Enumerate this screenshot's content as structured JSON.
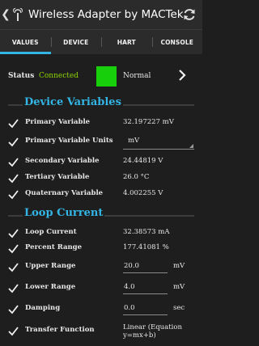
{
  "app": {
    "title": "Wireless Adapter by MACTek"
  },
  "tabs": [
    {
      "label": "VALUES",
      "active": true
    },
    {
      "label": "DEVICE",
      "active": false
    },
    {
      "label": "HART",
      "active": false
    },
    {
      "label": "CONSOLE",
      "active": false
    }
  ],
  "status": {
    "label": "Status",
    "value": "Connected",
    "indicator_color": "#17d00b",
    "text": "Normal"
  },
  "device_variables": {
    "title": "Device Variables",
    "rows": [
      {
        "label": "Primary Variable",
        "value": "32.197227 mV"
      },
      {
        "label": "Primary Variable Units",
        "value": "mV"
      },
      {
        "label": "Secondary Variable",
        "value": "24.44819 V"
      },
      {
        "label": "Tertiary Variable",
        "value": "26.0 °C"
      },
      {
        "label": "Quaternary Variable",
        "value": "4.002255 V"
      }
    ]
  },
  "loop_current": {
    "title": "Loop Current",
    "rows": [
      {
        "label": "Loop Current",
        "value": "32.38573 mA"
      },
      {
        "label": "Percent Range",
        "value": "177.41081 %"
      },
      {
        "label": "Upper Range",
        "value": "20.0",
        "unit": "mV"
      },
      {
        "label": "Lower Range",
        "value": "4.0",
        "unit": "mV"
      },
      {
        "label": "Damping",
        "value": "0.0",
        "unit": "sec"
      },
      {
        "label": "Transfer Function",
        "value": "Linear (Equation y=mx+b)"
      }
    ]
  },
  "colors": {
    "accent": "#33b5e5",
    "status_text": "#8fd400",
    "background": "#1e1e1e",
    "appbar": "#2b2b2b"
  }
}
